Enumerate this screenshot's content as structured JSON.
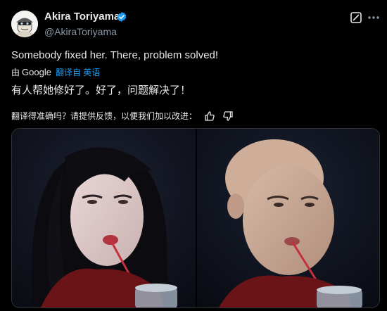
{
  "author": {
    "name": "Akira Toriyama",
    "handle": "@AkiraToriyama",
    "verified": true
  },
  "tweet": {
    "text": "Somebody fixed her. There, problem solved!"
  },
  "translation": {
    "by_label": "由",
    "provider": "Google",
    "translated_from": "翻译自 英语",
    "text": "有人帮她修好了。好了，问题解决了！"
  },
  "feedback": {
    "prompt": "翻译得准确吗？请提供反馈，以便我们加以改进："
  },
  "colors": {
    "background": "#000000",
    "text": "#e7e9ea",
    "secondary": "#8b98a5",
    "link": "#1d9bf0",
    "verified": "#1d9bf0"
  },
  "icons": {
    "verified": "verified-badge-icon",
    "grok": "grok-icon",
    "more": "more-options-icon",
    "thumbs_up": "thumbs-up-icon",
    "thumbs_down": "thumbs-down-icon"
  }
}
